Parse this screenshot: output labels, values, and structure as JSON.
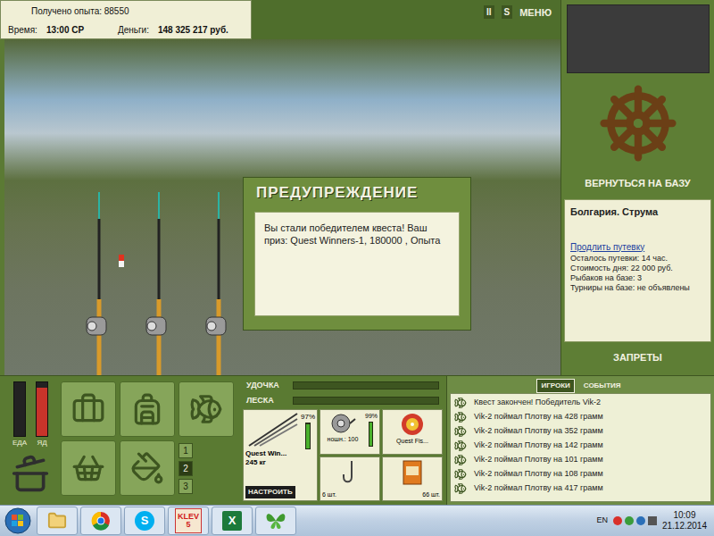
{
  "header": {
    "experience": "Получено опыта: 88550",
    "time_label": "Время:",
    "time": "13:00 СР",
    "money_label": "Деньги:",
    "money": "148 325 217 руб."
  },
  "top_buttons": [
    "II",
    "S",
    "МЕНЮ"
  ],
  "rods": [
    {
      "float": true
    },
    {
      "float": false
    },
    {
      "float": false
    }
  ],
  "dialog": {
    "title": "ПРЕДУПРЕЖДЕНИЕ",
    "message": "Вы стали победителем квеста! Ваш приз: Quest Winners-1, 180000 , Опыта"
  },
  "side": {
    "return_button": "ВЕРНУТЬСЯ НА БАЗУ",
    "location": "Болгария. Струма",
    "extend_link": "Продлить путевку",
    "info": [
      "Осталось путевки: 14 час.",
      "Стоимость дня: 22 000 руб.",
      "Рыбаков на базе: 3",
      "Турниры на базе: не объявлены"
    ],
    "bans_button": "ЗАПРЕТЫ"
  },
  "meters": [
    {
      "label": "ЕДА",
      "level": 0,
      "color": "#2a2a2a"
    },
    {
      "label": "ЯД",
      "level": 0.9,
      "color": "#c8342a"
    }
  ],
  "sets": [
    {
      "label": "1",
      "selected": false
    },
    {
      "label": "2",
      "selected": true
    },
    {
      "label": "3",
      "selected": false
    }
  ],
  "tension": [
    {
      "label": "УДОЧКА",
      "level": 0
    },
    {
      "label": "ЛЕСКА",
      "level": 0
    }
  ],
  "rod": {
    "name": "Quest Win...",
    "weight": "245 кг",
    "condition": "97%",
    "level": 0.97,
    "setup_button": "НАСТРОИТЬ"
  },
  "reel": {
    "label": "ношн.: 100",
    "condition": "99%",
    "level": 0.99
  },
  "line": {
    "name": "Quest Fis..."
  },
  "hook": {
    "count": "6 шт."
  },
  "bait": {
    "count": "66 шт."
  },
  "log": {
    "tabs": [
      {
        "label": "ИГРОКИ",
        "selected": true
      },
      {
        "label": "СОБЫТИЯ",
        "selected": false
      }
    ],
    "entries": [
      "Квест закончен! Победитель Vik-2",
      "Vik-2 поймал Плотву на 428 грамм",
      "Vik-2 поймал Плотву на 352 грамм",
      "Vik-2 поймал Плотву на 142 грамм",
      "Vik-2 поймал Плотву на 101 грамм",
      "Vik-2 поймал Плотву на 108 грамм",
      "Vik-2 поймал Плотву на 417 грамм"
    ]
  },
  "taskbar": {
    "apps": [
      {
        "kind": "folder",
        "text": "",
        "subtext": ""
      },
      {
        "kind": "chrome",
        "text": "",
        "subtext": ""
      },
      {
        "kind": "skype",
        "text": "S",
        "subtext": ""
      },
      {
        "kind": "klev",
        "text": "KLEV",
        "subtext": "5"
      },
      {
        "kind": "excel",
        "text": "X",
        "subtext": ""
      },
      {
        "kind": "butterfly",
        "text": "",
        "subtext": ""
      }
    ]
  },
  "tray": {
    "language": "EN",
    "time": "10:09",
    "date": "21.12.2014"
  }
}
